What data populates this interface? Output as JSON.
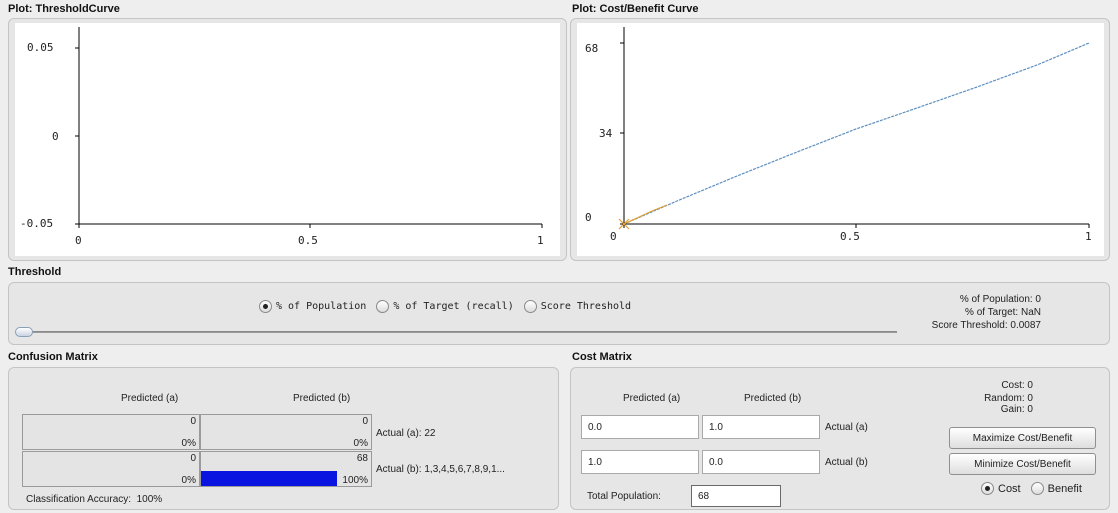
{
  "threshold_plot": {
    "title": "Plot: ThresholdCurve",
    "x_ticks": [
      "0",
      "0.5",
      "1"
    ],
    "y_ticks": [
      "0.05",
      "0",
      "-0.05"
    ]
  },
  "cost_plot": {
    "title": "Plot: Cost/Benefit Curve",
    "x_ticks": [
      "0",
      "0.5",
      "1"
    ],
    "y_ticks": [
      "68",
      "34",
      "0"
    ]
  },
  "threshold": {
    "title": "Threshold",
    "options": [
      "% of Population",
      "% of Target (recall)",
      "Score Threshold"
    ],
    "selected": "% of Population",
    "slider_value": 0,
    "stats": {
      "population": "% of Population: 0",
      "target": "% of Target: NaN",
      "score": "Score Threshold: 0.0087"
    }
  },
  "confusion_matrix": {
    "title": "Confusion Matrix",
    "headers": [
      "Predicted (a)",
      "Predicted (b)"
    ],
    "rows": [
      {
        "cells": [
          {
            "value": "0",
            "pct": "0%",
            "fill": 0
          },
          {
            "value": "0",
            "pct": "0%",
            "fill": 0
          }
        ],
        "label": "Actual (a): 22"
      },
      {
        "cells": [
          {
            "value": "0",
            "pct": "0%",
            "fill": 0
          },
          {
            "value": "68",
            "pct": "100%",
            "fill": 1
          }
        ],
        "label": "Actual (b): 1,3,4,5,6,7,8,9,1..."
      }
    ],
    "accuracy": "Classification Accuracy:  100%",
    "fill_color": "#0a14e0"
  },
  "cost_matrix": {
    "title": "Cost Matrix",
    "headers": [
      "Predicted (a)",
      "Predicted (b)"
    ],
    "rows": [
      {
        "values": [
          "0.0",
          "1.0"
        ],
        "label": "Actual (a)"
      },
      {
        "values": [
          "1.0",
          "0.0"
        ],
        "label": "Actual (b)"
      }
    ],
    "total_population_label": "Total Population:",
    "total_population_value": "68",
    "summary": {
      "cost": "Cost: 0",
      "random": "Random: 0",
      "gain": "Gain: 0"
    },
    "maximize_label": "Maximize Cost/Benefit",
    "minimize_label": "Minimize Cost/Benefit",
    "modes": [
      "Cost",
      "Benefit"
    ],
    "selected_mode": "Cost"
  }
}
